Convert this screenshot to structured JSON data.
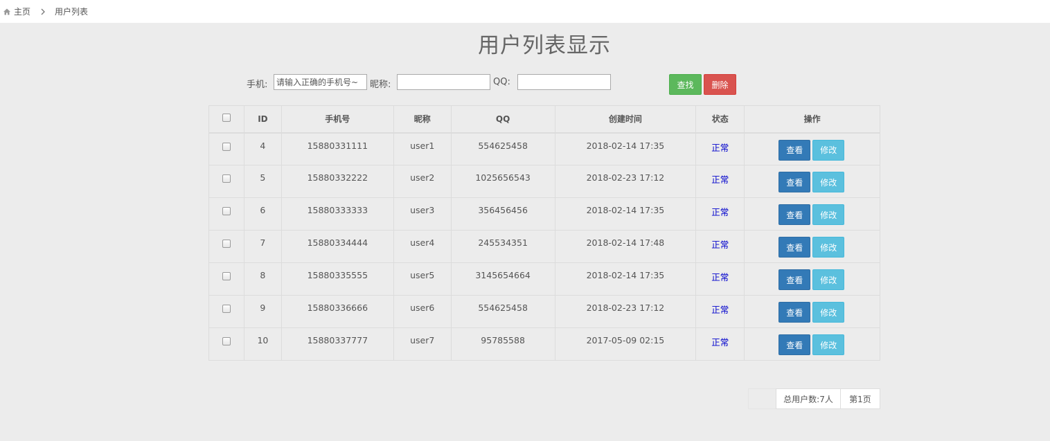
{
  "breadcrumb": {
    "home": "主页",
    "current": "用户列表"
  },
  "page_title": "用户列表显示",
  "search": {
    "phone_label": "手机:",
    "phone_placeholder": "请输入正确的手机号~",
    "nickname_label": "昵称:",
    "qq_label": "QQ:",
    "find_button": "查找",
    "delete_button": "删除"
  },
  "table": {
    "headers": [
      "ID",
      "手机号",
      "昵称",
      "QQ",
      "创建时间",
      "状态",
      "操作"
    ],
    "view_label": "查看",
    "edit_label": "修改",
    "rows": [
      {
        "id": "4",
        "phone": "15880331111",
        "nickname": "user1",
        "qq": "554625458",
        "created": "2018-02-14 17:35",
        "status": "正常"
      },
      {
        "id": "5",
        "phone": "15880332222",
        "nickname": "user2",
        "qq": "1025656543",
        "created": "2018-02-23 17:12",
        "status": "正常"
      },
      {
        "id": "6",
        "phone": "15880333333",
        "nickname": "user3",
        "qq": "356456456",
        "created": "2018-02-14 17:35",
        "status": "正常"
      },
      {
        "id": "7",
        "phone": "15880334444",
        "nickname": "user4",
        "qq": "245534351",
        "created": "2018-02-14 17:48",
        "status": "正常"
      },
      {
        "id": "8",
        "phone": "15880335555",
        "nickname": "user5",
        "qq": "3145654664",
        "created": "2018-02-14 17:35",
        "status": "正常"
      },
      {
        "id": "9",
        "phone": "15880336666",
        "nickname": "user6",
        "qq": "554625458",
        "created": "2018-02-23 17:12",
        "status": "正常"
      },
      {
        "id": "10",
        "phone": "15880337777",
        "nickname": "user7",
        "qq": "95785588",
        "created": "2017-05-09 02:15",
        "status": "正常"
      }
    ]
  },
  "pager": {
    "total": "总用户数:7人",
    "page": "第1页"
  },
  "colors": {
    "status": "#0000cc",
    "find": "#5cb85c",
    "delete": "#d9534f",
    "view": "#337ab7",
    "edit": "#5bc0de"
  },
  "icons": {
    "home": "home-icon",
    "separator": "chevron-right-icon"
  }
}
